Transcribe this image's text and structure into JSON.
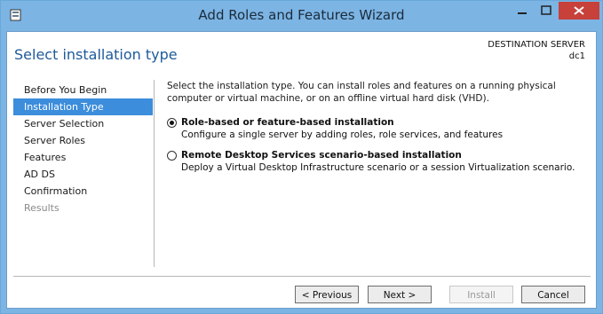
{
  "window": {
    "title": "Add Roles and Features Wizard"
  },
  "header": {
    "title": "Select installation type",
    "destination_label": "DESTINATION SERVER",
    "destination_name": "dc1"
  },
  "nav": {
    "items": [
      {
        "label": "Before You Begin"
      },
      {
        "label": "Installation Type"
      },
      {
        "label": "Server Selection"
      },
      {
        "label": "Server Roles"
      },
      {
        "label": "Features"
      },
      {
        "label": "AD DS"
      },
      {
        "label": "Confirmation"
      },
      {
        "label": "Results"
      }
    ]
  },
  "content": {
    "description": "Select the installation type. You can install roles and features on a running physical computer or virtual machine, or on an offline virtual hard disk (VHD).",
    "options": [
      {
        "title": "Role-based or feature-based installation",
        "description": "Configure a single server by adding roles, role services, and features"
      },
      {
        "title": "Remote Desktop Services scenario-based installation",
        "description": "Deploy a Virtual Desktop Infrastructure scenario or a session Virtualization scenario."
      }
    ]
  },
  "buttons": {
    "previous": "< Previous",
    "next": "Next >",
    "install": "Install",
    "cancel": "Cancel"
  },
  "colors": {
    "titlebar": "#7cb4e4",
    "accent": "#3c8ddb",
    "header_text": "#1e5a9a",
    "close": "#c7403a"
  },
  "icons": {
    "app": "server-icon",
    "minimize": "minimize-icon",
    "maximize": "maximize-icon",
    "close": "close-icon"
  }
}
